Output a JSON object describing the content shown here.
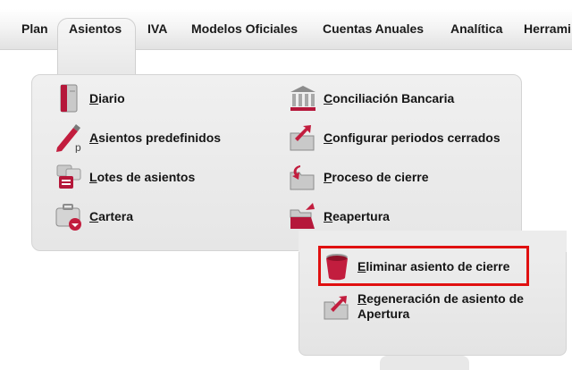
{
  "menubar": {
    "items": [
      "Plan",
      "Asientos",
      "IVA",
      "Modelos Oficiales",
      "Cuentas Anuales",
      "Analítica",
      "Herrami"
    ]
  },
  "panel": {
    "left_column": [
      {
        "label": "Diario",
        "icon": "book-icon"
      },
      {
        "label": "Asientos predefinidos",
        "icon": "pencil-icon"
      },
      {
        "label": "Lotes de asientos",
        "icon": "documents-stack-icon"
      },
      {
        "label": "Cartera",
        "icon": "briefcase-icon"
      }
    ],
    "right_column": [
      {
        "label": "Conciliación Bancaria",
        "icon": "bank-icon"
      },
      {
        "label": "Configurar periodos cerrados",
        "icon": "folder-arrow-icon"
      },
      {
        "label": "Proceso de cierre",
        "icon": "folder-close-icon"
      },
      {
        "label": "Reapertura",
        "icon": "folder-open-icon"
      }
    ]
  },
  "submenu": {
    "items": [
      {
        "label": "Eliminar asiento de cierre",
        "icon": "trash-icon"
      },
      {
        "label": "Regeneración de asiento de Apertura",
        "icon": "folder-regenerate-icon"
      }
    ]
  },
  "colors": {
    "accent": "#b5173a",
    "highlight_border": "#e01010"
  }
}
